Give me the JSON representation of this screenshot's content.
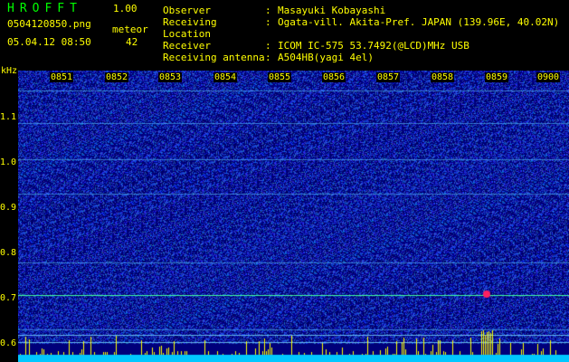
{
  "header": {
    "app_name": "HROFFT",
    "version": "1.00",
    "filename": "0504120850.png",
    "datetime": "05.04.12 08:50",
    "meteor_label": "meteor",
    "meteor_count": "42"
  },
  "info": [
    {
      "key": "Observer",
      "sep": ":",
      "value": "Masayuki Kobayashi"
    },
    {
      "key": "Receiving Location",
      "sep": ":",
      "value": "Ogata-vill. Akita-Pref. JAPAN (139.96E, 40.02N)"
    },
    {
      "key": "Receiver",
      "sep": ":",
      "value": "ICOM IC-575 53.7492(@LCD)MHz USB"
    },
    {
      "key": "Receiving antenna",
      "sep": ":",
      "value": "A504HB(yagi 4el)"
    }
  ],
  "spectrogram": {
    "unit": "kHz",
    "y_ticks": [
      "1.1",
      "1.0",
      "0.9",
      "0.8",
      "0.7",
      "0.6"
    ],
    "x_ticks": [
      "0851",
      "0852",
      "0853",
      "0854",
      "0855",
      "0856",
      "0857",
      "0858",
      "0859",
      "0900"
    ],
    "colors": {
      "background": "#00007a",
      "noise": "#1f3fff",
      "line": "#40ffa0",
      "meteor": "#ff2060",
      "bar": "#ffff00",
      "base": "#00c8ff"
    }
  }
}
